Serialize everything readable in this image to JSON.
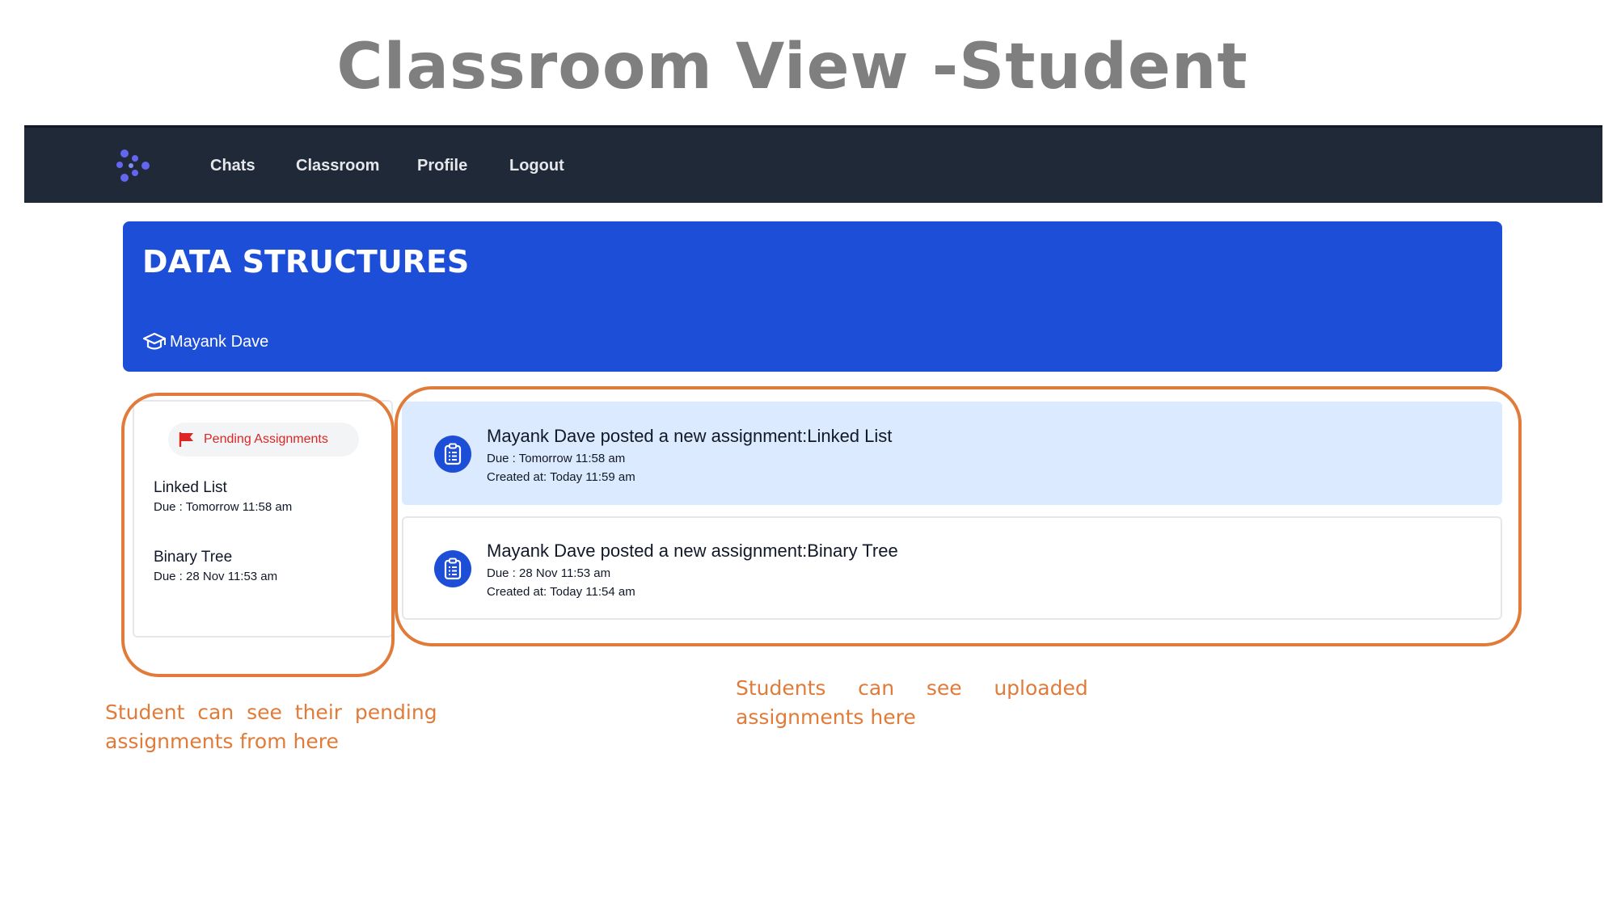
{
  "slide": {
    "title": "Classroom View -Student"
  },
  "nav": {
    "logo_icon": "app-logo-icon",
    "links": [
      "Chats",
      "Classroom",
      "Profile",
      "Logout"
    ]
  },
  "banner": {
    "course_title": "DATA STRUCTURES",
    "teacher_icon": "graduation-cap-icon",
    "teacher_name": "Mayank Dave",
    "color": "#1d4ed8"
  },
  "pending": {
    "label": "Pending Assignments",
    "icon": "flag-icon",
    "color": "#dc2626",
    "items": [
      {
        "name": "Linked List",
        "due": "Due : Tomorrow 11:58 am"
      },
      {
        "name": "Binary Tree",
        "due": "Due : 28 Nov 11:53 am"
      }
    ]
  },
  "feed": {
    "icon": "clipboard-icon",
    "items": [
      {
        "headline": "Mayank Dave posted a new assignment:Linked List",
        "due": "Due : Tomorrow 11:58 am",
        "created": "Created at: Today 11:59 am"
      },
      {
        "headline": "Mayank Dave posted a new assignment:Binary Tree",
        "due": "Due : 28 Nov 11:53 am",
        "created": "Created at: Today 11:54 am"
      }
    ]
  },
  "annotations": {
    "left_note": [
      "Student  can  see  their  pending",
      "assignments from here"
    ],
    "right_note": [
      "Students     can     see     uploaded",
      "assignments here"
    ],
    "color": "#e07b39"
  }
}
